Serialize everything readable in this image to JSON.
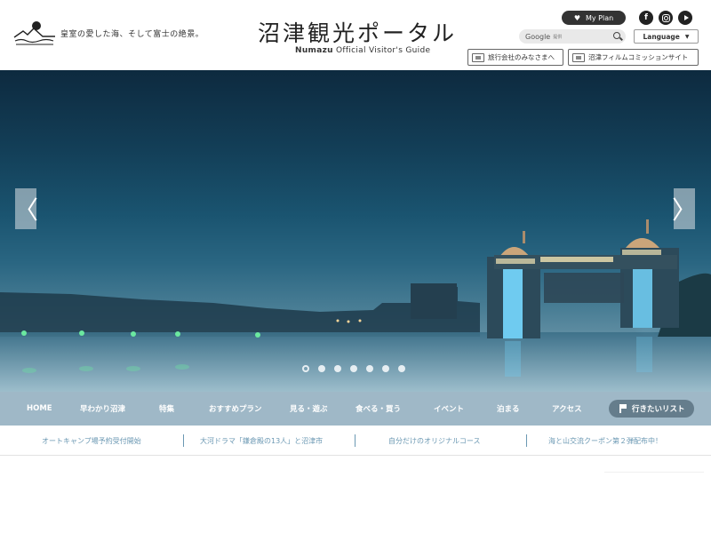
{
  "header": {
    "tagline": "皇室の愛した海、そして富士の絶景。",
    "site_title": "沼津観光ポータル",
    "site_sub_bold": "Numazu",
    "site_sub_rest": " Official Visitor's Guide",
    "myplan_label": "My Plan",
    "search_brand": "Google",
    "search_brand_sub": "提供",
    "language_label": "Language",
    "links": [
      {
        "label": "旅行会社のみなさまへ"
      },
      {
        "label": "沼津フィルムコミッションサイト"
      }
    ],
    "sns": [
      "facebook-icon",
      "instagram-icon",
      "youtube-icon"
    ]
  },
  "hero": {
    "prev_label": "〈",
    "next_label": "〉",
    "slide_count": 7,
    "active_slide": 1
  },
  "nav": {
    "items": [
      {
        "label": "HOME"
      },
      {
        "label": "早わかり沼津"
      },
      {
        "label": "特集"
      },
      {
        "label": "おすすめプラン"
      },
      {
        "label": "見る・遊ぶ"
      },
      {
        "label": "食べる・買う"
      },
      {
        "label": "イベント"
      },
      {
        "label": "泊まる"
      },
      {
        "label": "アクセス"
      }
    ],
    "wish_label": "行きたいリスト"
  },
  "news": {
    "items": [
      {
        "label": "オートキャンプ場予約受付開始"
      },
      {
        "label": "大河ドラマ「鎌倉殿の13人」と沼津市"
      },
      {
        "label": "自分だけのオリジナルコース"
      },
      {
        "label": "海と山交流クーポン第２弾配布中！"
      }
    ]
  },
  "colors": {
    "nav_bg": "#9fb8c7",
    "wish_bg": "#657d8c",
    "news_text": "#6b98b3"
  }
}
